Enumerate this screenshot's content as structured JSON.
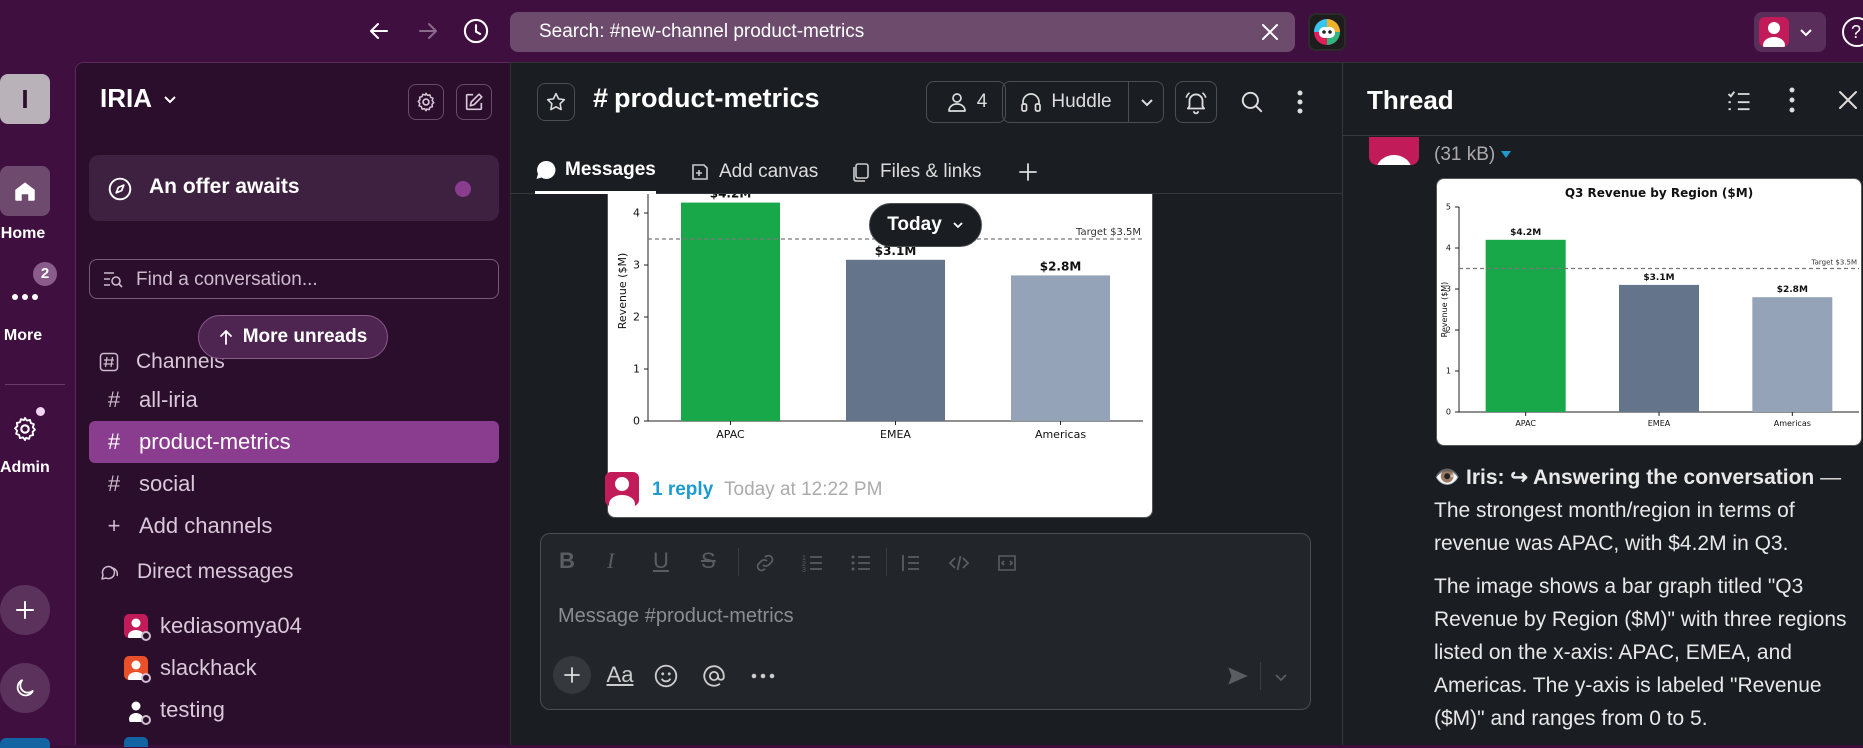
{
  "top": {
    "search_text": "Search: #new-channel product-metrics"
  },
  "rail": {
    "workspace_initial": "I",
    "home_label": "Home",
    "more_label": "More",
    "more_badge": "2",
    "admin_label": "Admin"
  },
  "sidebar": {
    "workspace_name": "IRIA",
    "offer_text": "An offer awaits",
    "find_placeholder": "Find a conversation...",
    "more_unreads": "More unreads",
    "channels_header": "Channels",
    "channels": [
      {
        "label": "all-iria"
      },
      {
        "label": "product-metrics"
      },
      {
        "label": "social"
      }
    ],
    "add_channels": "Add channels",
    "dm_header": "Direct messages",
    "dms": [
      {
        "label": "kediasomya04",
        "avatar_color": "#c21b5a"
      },
      {
        "label": "slackhack",
        "avatar_color": "#e8502a"
      },
      {
        "label": "testing",
        "avatar_color": "#3b3b3b"
      }
    ]
  },
  "channel": {
    "name": "product-metrics",
    "member_count": "4",
    "huddle_label": "Huddle",
    "tabs": [
      {
        "label": "Messages"
      },
      {
        "label": "Add canvas"
      },
      {
        "label": "Files & links"
      }
    ],
    "today_label": "Today",
    "reply_link": "1 reply",
    "reply_time": "Today at 12:22 PM",
    "composer_placeholder": "Message #product-metrics"
  },
  "thread": {
    "title": "Thread",
    "file_size": "(31 kB)",
    "iris_name": "Iris:",
    "answer_header": "↪ Answering the conversation",
    "answer_dash": "—",
    "answer_text": "The strongest month/region in terms of revenue was APAC, with $4.2M in Q3.",
    "description": "The image shows a bar graph titled \"Q3 Revenue by Region ($M)\" with three regions listed on the x-axis: APAC, EMEA, and Americas. The y-axis is labeled \"Revenue ($M)\" and ranges from 0 to 5."
  },
  "chart_data": {
    "type": "bar",
    "title": "Q3 Revenue by Region ($M)",
    "categories": [
      "APAC",
      "EMEA",
      "Americas"
    ],
    "values": [
      4.2,
      3.1,
      2.8
    ],
    "data_labels": [
      "$4.2M",
      "$3.1M",
      "$2.8M"
    ],
    "colors": [
      "#18a84a",
      "#64748b",
      "#94a3b8"
    ],
    "ylabel": "Revenue ($M)",
    "xlabel": "",
    "ylim": [
      0,
      5
    ],
    "yticks": [
      0,
      1,
      2,
      3,
      4,
      5
    ],
    "target": 3.5,
    "target_label": "Target $3.5M"
  }
}
